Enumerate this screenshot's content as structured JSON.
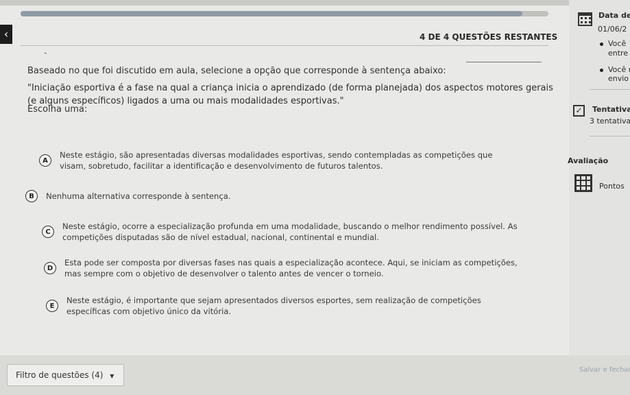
{
  "header": {
    "remaining": "4 DE 4 QUESTÕES RESTANTES",
    "dash": "-"
  },
  "question": {
    "prompt": "Baseado no que foi discutido em aula, selecione a opção que corresponde à sentença abaixo:",
    "statement": "\"Iniciação esportiva é a fase na qual a criança inicia o aprendizado (de forma planejada) dos aspectos motores gerais (e alguns específicos) ligados a uma ou mais modalidades esportivas.\"",
    "choose_label": "Escolha uma:",
    "options": [
      {
        "letter": "A",
        "text": "Neste estágio, são apresentadas diversas modalidades esportivas, sendo contempladas as competições que visam, sobretudo, facilitar a identificação e desenvolvimento de futuros talentos."
      },
      {
        "letter": "B",
        "text": "Nenhuma alternativa corresponde à sentença."
      },
      {
        "letter": "C",
        "text": "Neste estágio, ocorre a especialização profunda em uma modalidade, buscando o melhor rendimento possível. As competições disputadas são de nível estadual, nacional, continental e mundial."
      },
      {
        "letter": "D",
        "text": "Esta pode ser composta por diversas fases nas quais a especialização acontece. Aqui, se iniciam as competições, mas sempre com o objetivo de desenvolver o talento antes de vencer o torneio."
      },
      {
        "letter": "E",
        "text": "Neste estágio, é importante que sejam apresentados diversos esportes, sem realização de competições específicas com objetivo único da vitória."
      }
    ]
  },
  "footer": {
    "filter_label": "Filtro de questões (4)",
    "dropdown_arrow": "▼",
    "save_label": "Salvar e fechar"
  },
  "sidebar": {
    "date_label": "Data de",
    "date_value": "01/06/2",
    "bullet1_line1": "Você",
    "bullet1_line2": "entre",
    "bullet2_line1": "Você r",
    "bullet2_line2": "envio",
    "attempts_label": "Tentativa",
    "attempts_value": "3 tentativa",
    "evaluation_label": "Avaliação",
    "points_label": "Pontos"
  },
  "icons": {
    "back": "chevron-left-icon",
    "calendar": "calendar-icon",
    "attempts": "checkbox-icon",
    "points": "grid-icon"
  },
  "progress": {
    "fraction": 0.95
  }
}
